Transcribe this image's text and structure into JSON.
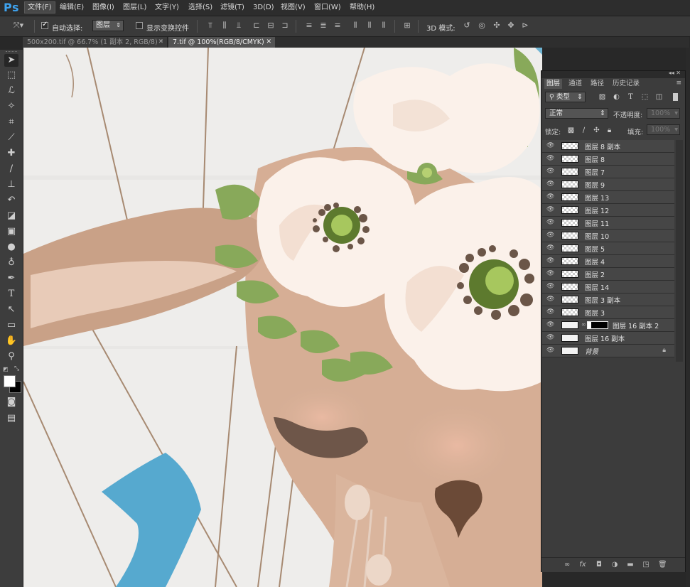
{
  "app": {
    "logo": "Ps"
  },
  "menu": [
    "文件(F)",
    "编辑(E)",
    "图像(I)",
    "图层(L)",
    "文字(Y)",
    "选择(S)",
    "滤镜(T)",
    "3D(D)",
    "视图(V)",
    "窗口(W)",
    "帮助(H)"
  ],
  "options": {
    "auto_select_label": "自动选择:",
    "auto_select_checked": true,
    "auto_select_value": "图层",
    "show_transform_label": "显示变换控件",
    "show_transform_checked": false,
    "mode_3d_label": "3D 模式:"
  },
  "doc_tabs": [
    {
      "label": "500x200.tif @ 66.7% (1 副本 2, RGB/8) *",
      "active": false
    },
    {
      "label": "7.tif @ 100%(RGB/8/CMYK)",
      "active": true
    }
  ],
  "tools": [
    "move-icon",
    "marquee-icon",
    "lasso-icon",
    "magic-wand-icon",
    "crop-icon",
    "eyedropper-icon",
    "healing-brush-icon",
    "brush-icon",
    "stamp-icon",
    "history-brush-icon",
    "eraser-icon",
    "gradient-icon",
    "blur-icon",
    "dodge-icon",
    "pen-icon",
    "type-icon",
    "path-select-icon",
    "rectangle-icon",
    "hand-icon",
    "zoom-icon"
  ],
  "colors": {
    "foreground": "#ffffff",
    "background": "#000000"
  },
  "panel": {
    "tabs": [
      "图层",
      "通道",
      "路径",
      "历史记录"
    ],
    "filter_kind": "类型",
    "blend_mode": "正常",
    "opacity_label": "不透明度:",
    "opacity_value": "100%",
    "lock_label": "锁定:",
    "fill_label": "填充:",
    "fill_value": "100%"
  },
  "layers": [
    {
      "name": "图层 8 副本",
      "thumb": "checker"
    },
    {
      "name": "图层 8",
      "thumb": "checker"
    },
    {
      "name": "图层 7",
      "thumb": "checker"
    },
    {
      "name": "图层 9",
      "thumb": "checker"
    },
    {
      "name": "图层 13",
      "thumb": "checker"
    },
    {
      "name": "图层 12",
      "thumb": "checker"
    },
    {
      "name": "图层 11",
      "thumb": "checker"
    },
    {
      "name": "图层 10",
      "thumb": "checker"
    },
    {
      "name": "图层 5",
      "thumb": "checker"
    },
    {
      "name": "图层 4",
      "thumb": "checker"
    },
    {
      "name": "图层 2",
      "thumb": "checker"
    },
    {
      "name": "图层 14",
      "thumb": "checker"
    },
    {
      "name": "图层 3 副本",
      "thumb": "checker"
    },
    {
      "name": "图层 3",
      "thumb": "checker"
    },
    {
      "name": "图层 16 副本 2",
      "thumb": "white",
      "mask": true
    },
    {
      "name": "图层 16 副本",
      "thumb": "white"
    },
    {
      "name": "背景",
      "thumb": "white",
      "locked": true,
      "italic": true
    }
  ],
  "panel_bottom_icons": [
    "link-icon",
    "fx-icon",
    "mask-icon",
    "adjustment-icon",
    "group-icon",
    "new-layer-icon",
    "trash-icon"
  ]
}
